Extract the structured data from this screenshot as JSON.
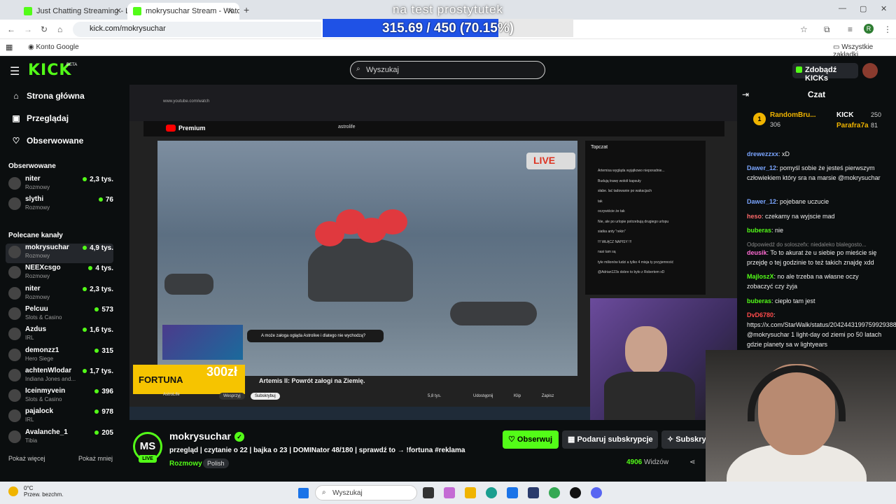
{
  "browser": {
    "tabs": [
      {
        "title": "Just Chatting Streaming - Live S",
        "active": false
      },
      {
        "title": "mokrysuchar Stream - Watch Li",
        "active": true
      }
    ],
    "url": "kick.com/mokrysuchar",
    "bookmarks": {
      "google": "Konto Google",
      "all": "Wszystkie zakładki"
    },
    "profile_initial": "R"
  },
  "goal_overlay": {
    "title": "na test prostytutek",
    "text": "315.69 / 450 (70.15%)",
    "progress": 0.7015
  },
  "kick": {
    "logo": "KICK",
    "beta": "BETA",
    "search_placeholder": "Wyszukaj",
    "kicks_button": "Zdobądź KICKs",
    "nav": [
      "Strona główna",
      "Przeglądaj",
      "Obserwowane"
    ],
    "following_heading": "Obserwowane",
    "following": [
      {
        "name": "niter",
        "category": "Rozmowy",
        "viewers": "2,3 tys."
      },
      {
        "name": "slythi",
        "category": "Rozmowy",
        "viewers": "76"
      }
    ],
    "recommended_heading": "Polecane kanały",
    "recommended": [
      {
        "name": "mokrysuchar",
        "category": "Rozmowy",
        "viewers": "4,9 tys."
      },
      {
        "name": "NEEXcsgo",
        "category": "Rozmowy",
        "viewers": "4 tys."
      },
      {
        "name": "niter",
        "category": "Rozmowy",
        "viewers": "2,3 tys."
      },
      {
        "name": "Pelcuu",
        "category": "Slots & Casino",
        "viewers": "573"
      },
      {
        "name": "Azdus",
        "category": "IRL",
        "viewers": "1,6 tys."
      },
      {
        "name": "demonzz1",
        "category": "Hero Siege",
        "viewers": "315"
      },
      {
        "name": "achtenWlodar",
        "category": "Indiana Jones and...",
        "viewers": "1,7 tys."
      },
      {
        "name": "Iceinmyvein",
        "category": "Slots & Casino",
        "viewers": "396"
      },
      {
        "name": "pajalock",
        "category": "IRL",
        "viewers": "978"
      },
      {
        "name": "Avalanche_1",
        "category": "Tibia",
        "viewers": "205"
      }
    ],
    "show_more": "Pokaż więcej",
    "show_less": "Pokaż mniej"
  },
  "video": {
    "yt_search": "astrolife",
    "yt_logo": "Premium",
    "yt_chat_header": "Topczat",
    "caption": "Artemis II: Powrót załogi na Ziemię.",
    "fortuna": "FORTUNA",
    "fortuna_bonus": "300zł",
    "live_badge": "LIVE",
    "yt_likes": "5,8 tys.",
    "yt_share": "Udostępnij",
    "yt_clip": "Klip",
    "yt_save": "Zapisz",
    "yt_channel": "AstroLife",
    "yt_support": "Wesprzyj",
    "yt_subscribe": "Subskrybuj",
    "question": "A może załoga ogląda Astrolive i dlatego nie wychodzą?",
    "yt_chat": [
      "Artemisa wygląda wyjątkowo nieporadnie...",
      "Budują trawę wokół kapsuły",
      "słabe. lać tadowanie po wakacjach",
      "tak",
      "oczywiście że tak",
      "Nie, ale po urlopie potrzebują drugiego urlopu",
      "siatka anty \"rekin\"",
      "!!! WŁĄCZ NAPISY !!!",
      "nasi tam są",
      "tyle milionów ludzi a tylko 4 misja ty przyjemność",
      "@Adrian123s dobre to było z Robertem xD"
    ]
  },
  "stream": {
    "streamer": "mokrysuchar",
    "avatar_initials": "MS",
    "live": "LIVE",
    "title": "przegląd | czytanie o 22 | bajka o 23 | DOMINator 48/180 | sprawdź to → !fortuna  #reklama",
    "category": "Rozmowy",
    "language": "Polish",
    "follow": "Obserwuj",
    "gift": "Podaruj subskrypcje",
    "subscribe": "Subskry",
    "viewers_count": "4906",
    "viewers_label": "Widzów"
  },
  "chat": {
    "title": "Czat",
    "leaderboard": [
      {
        "name": "RandomBru...",
        "value": "306"
      },
      {
        "name": "KICK",
        "value": "250"
      },
      {
        "name": "Parafra7a",
        "value": "81"
      }
    ],
    "messages": [
      {
        "user": "drewezzxx",
        "color": "#7aa5ff",
        "text": "xD"
      },
      {
        "user": "Dawer_12",
        "color": "#7aa5ff",
        "text": "pomyśl sobie że jesteś pierwszym człowiekiem który sra na marsie @mokrysuchar"
      },
      {
        "user": "Dawer_12",
        "color": "#7aa5ff",
        "text": "pojebane uczucie"
      },
      {
        "user": "heso",
        "color": "#ff6b6b",
        "text": "czekamy na wyjscie mad"
      },
      {
        "user": "buberas",
        "color": "#53fc18",
        "text": "nie"
      },
      {
        "user": "",
        "color": "#888",
        "text": "Odpowiedź do soloszefx: niedaleko blalegosto..."
      },
      {
        "user": "deusik",
        "color": "#ff6bd4",
        "text": "To to akurat że u siebie po mieście się przejdę o tej godzinie to też takich znajdę xdd"
      },
      {
        "user": "MajloszX",
        "color": "#53fc18",
        "text": "no ale trzeba na własne oczy zobaczyć czy żyja"
      },
      {
        "user": "buberas",
        "color": "#53fc18",
        "text": "ciepło tam jest"
      },
      {
        "user": "DvD6780",
        "color": "#ff4b4b",
        "text": "https://x.com/StarWalk/status/2042443199759929388 @mokrysuchar 1 light-day od ziemi po 50 latach gdzie planety sa w lightyears"
      }
    ]
  },
  "taskbar": {
    "temp": "0°C",
    "weather": "Przew. bezchm.",
    "search": "Wyszukaj"
  }
}
